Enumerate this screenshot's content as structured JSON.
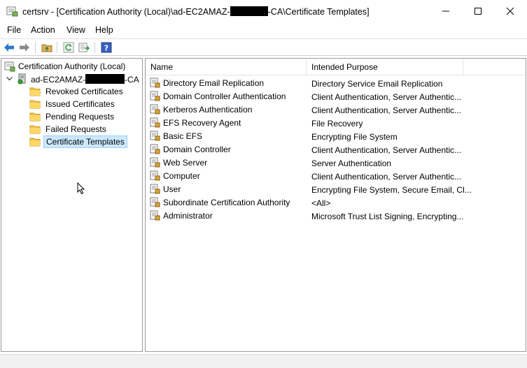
{
  "window": {
    "title_prefix": "certsrv - [Certification Authority (Local)\\ad-EC2AMAZ-",
    "title_suffix": "-CA\\Certificate Templates]",
    "minimize_icon": "minimize-icon",
    "maximize_icon": "maximize-icon",
    "close_icon": "close-icon"
  },
  "menu": {
    "file": "File",
    "action": "Action",
    "view": "View",
    "help": "Help"
  },
  "toolbar": {
    "buttons": [
      "back-arrow-icon",
      "forward-arrow-icon",
      "up-folder-icon",
      "refresh-icon",
      "export-list-icon",
      "help-icon"
    ]
  },
  "tree": {
    "root_label": "Certification Authority (Local)",
    "ca_prefix": "ad-EC2AMAZ-",
    "ca_suffix": "-CA",
    "children": [
      {
        "label": "Revoked Certificates"
      },
      {
        "label": "Issued Certificates"
      },
      {
        "label": "Pending Requests"
      },
      {
        "label": "Failed Requests"
      },
      {
        "label": "Certificate Templates",
        "selected": true
      }
    ]
  },
  "list": {
    "columns": {
      "name": "Name",
      "purpose": "Intended Purpose"
    },
    "rows": [
      {
        "name": "Directory Email Replication",
        "purpose": "Directory Service Email Replication"
      },
      {
        "name": "Domain Controller Authentication",
        "purpose": "Client Authentication, Server Authentic..."
      },
      {
        "name": "Kerberos Authentication",
        "purpose": "Client Authentication, Server Authentic..."
      },
      {
        "name": "EFS Recovery Agent",
        "purpose": "File Recovery"
      },
      {
        "name": "Basic EFS",
        "purpose": "Encrypting File System"
      },
      {
        "name": "Domain Controller",
        "purpose": "Client Authentication, Server Authentic..."
      },
      {
        "name": "Web Server",
        "purpose": "Server Authentication"
      },
      {
        "name": "Computer",
        "purpose": "Client Authentication, Server Authentic..."
      },
      {
        "name": "User",
        "purpose": "Encrypting File System, Secure Email, Cl..."
      },
      {
        "name": "Subordinate Certification Authority",
        "purpose": "<All>"
      },
      {
        "name": "Administrator",
        "purpose": "Microsoft Trust List Signing, Encrypting..."
      }
    ]
  },
  "colors": {
    "selection": "#cce8ff",
    "selection_border": "#99d1ff",
    "folder": "#f5c54a",
    "toolbar_arrow": "#2e78c9"
  }
}
